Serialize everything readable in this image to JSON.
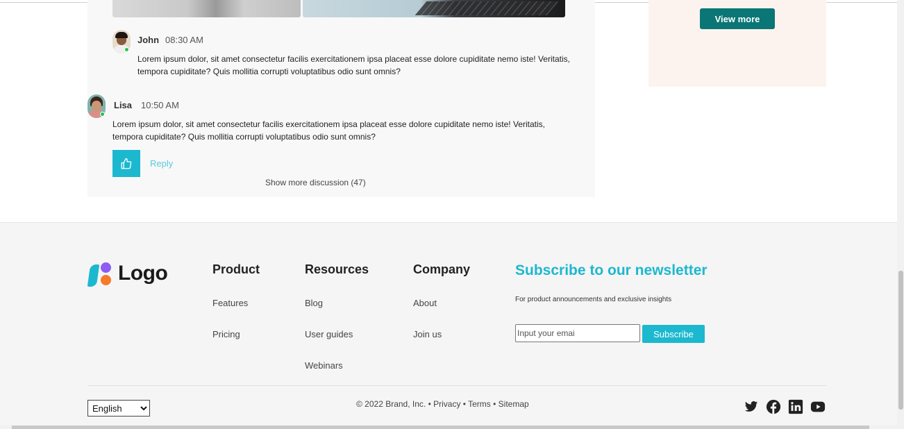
{
  "discussion": {
    "comments": [
      {
        "author": "John",
        "time": "08:30 AM",
        "text": "Lorem ipsum dolor, sit amet consectetur facilis exercitationem ipsa placeat esse dolore cupiditate nemo iste! Veritatis, tempora cupiditate? Quis mollitia corrupti voluptatibus odio sunt omnis?",
        "online": true
      },
      {
        "author": "Lisa",
        "time": "10:50 AM",
        "text": "Lorem ipsum dolor, sit amet consectetur facilis exercitationem ipsa placeat esse dolore cupiditate nemo iste! Veritatis, tempora cupiditate? Quis mollitia corrupti voluptatibus odio sunt omnis?",
        "online": true
      }
    ],
    "reply_label": "Reply",
    "show_more_label": "Show more discussion (47)",
    "like_icon": "thumbs-up-icon"
  },
  "promo": {
    "view_more_label": "View more"
  },
  "footer": {
    "logo_text": "Logo",
    "columns": [
      {
        "title": "Product",
        "links": [
          "Features",
          "Pricing"
        ]
      },
      {
        "title": "Resources",
        "links": [
          "Blog",
          "User guides",
          "Webinars"
        ]
      },
      {
        "title": "Company",
        "links": [
          "About",
          "Join us"
        ]
      }
    ],
    "newsletter": {
      "title": "Subscribe to our newsletter",
      "subtitle": "For product announcements and exclusive insights",
      "email_placeholder": "Input your emai",
      "subscribe_label": "Subscribe"
    },
    "language": {
      "selected": "English"
    },
    "copyright": "© 2022 Brand, Inc.",
    "legal_links": [
      "Privacy",
      "Terms",
      "Sitemap"
    ],
    "social": [
      "twitter-icon",
      "facebook-icon",
      "linkedin-icon",
      "youtube-icon"
    ]
  },
  "colors": {
    "accent": "#1cb8cf",
    "button_dark": "#0a7675",
    "online": "#25c447"
  }
}
